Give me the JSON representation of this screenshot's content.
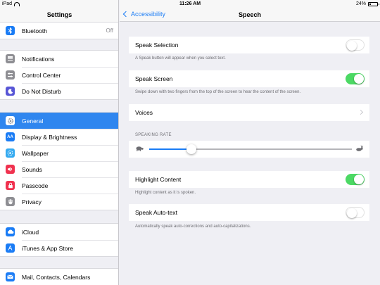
{
  "status": {
    "device": "iPad",
    "time": "11:26 AM",
    "battery": "24%",
    "battery_level": 0.24
  },
  "left": {
    "title": "Settings",
    "groups": [
      [
        {
          "label": "Bluetooth",
          "value": "Off",
          "icon": "bluetooth-icon",
          "color": "#1a7cf5"
        }
      ],
      [
        {
          "label": "Notifications",
          "icon": "notifications-icon",
          "color": "#8e8e93"
        },
        {
          "label": "Control Center",
          "icon": "control-center-icon",
          "color": "#8e8e93"
        },
        {
          "label": "Do Not Disturb",
          "icon": "moon-icon",
          "color": "#5856d6"
        }
      ],
      [
        {
          "label": "General",
          "icon": "gear-icon",
          "color": "#8e8e93",
          "selected": true
        },
        {
          "label": "Display & Brightness",
          "icon": "display-icon",
          "color": "#1a7cf5"
        },
        {
          "label": "Wallpaper",
          "icon": "wallpaper-icon",
          "color": "#35aaf0"
        },
        {
          "label": "Sounds",
          "icon": "speaker-icon",
          "color": "#f0324f"
        },
        {
          "label": "Passcode",
          "icon": "lock-icon",
          "color": "#f0324f"
        },
        {
          "label": "Privacy",
          "icon": "hand-icon",
          "color": "#8e8e93"
        }
      ],
      [
        {
          "label": "iCloud",
          "icon": "cloud-icon",
          "color": "#1a7cf5"
        },
        {
          "label": "iTunes & App Store",
          "icon": "app-store-icon",
          "color": "#1a7cf5"
        }
      ],
      [
        {
          "label": "Mail, Contacts, Calendars",
          "icon": "mail-icon",
          "color": "#1a7cf5"
        }
      ]
    ]
  },
  "right": {
    "back_label": "Accessibility",
    "title": "Speech",
    "speak_selection": {
      "label": "Speak Selection",
      "on": false,
      "note": "A Speak button will appear when you select text."
    },
    "speak_screen": {
      "label": "Speak Screen",
      "on": true,
      "note": "Swipe down with two fingers from the top of the screen to hear the content of the screen."
    },
    "voices": {
      "label": "Voices"
    },
    "speaking_rate": {
      "header": "SPEAKING RATE",
      "value": 0.21
    },
    "highlight_content": {
      "label": "Highlight Content",
      "on": true,
      "note": "Highlight content as it is spoken."
    },
    "speak_auto_text": {
      "label": "Speak Auto-text",
      "on": false,
      "note": "Automatically speak auto-corrections and auto-capitalizations."
    }
  },
  "colors": {
    "accent": "#1a7cf5",
    "toggle_on": "#4cd964",
    "selection": "#2f86ef"
  }
}
